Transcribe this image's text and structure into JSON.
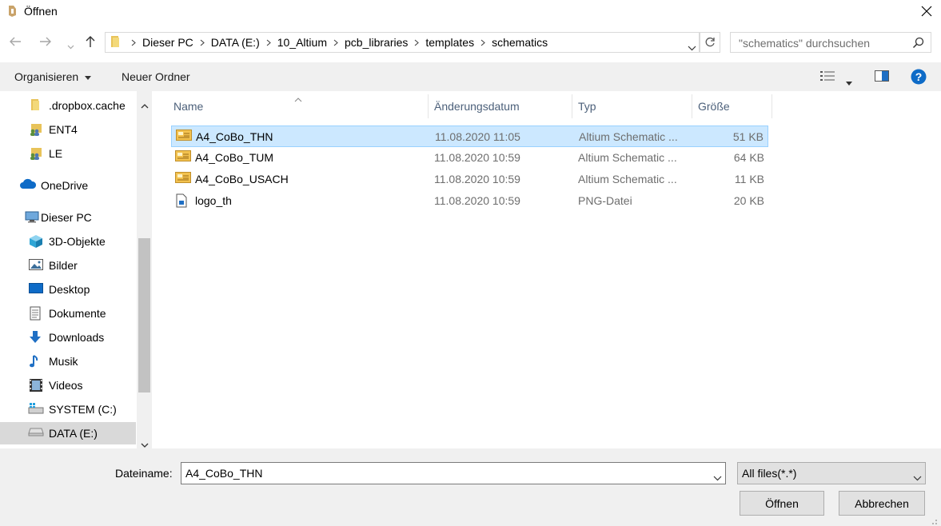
{
  "window": {
    "title": "Öffnen"
  },
  "address": {
    "crumbs": [
      "Dieser PC",
      "DATA (E:)",
      "10_Altium",
      "pcb_libraries",
      "templates",
      "schematics"
    ]
  },
  "search": {
    "placeholder": "\"schematics\" durchsuchen"
  },
  "toolbar": {
    "organize": "Organisieren",
    "new_folder": "Neuer Ordner"
  },
  "nav_pane": {
    "items": [
      {
        "label": ".dropbox.cache",
        "icon": "folder-icon"
      },
      {
        "label": "ENT4",
        "icon": "shared-folder-icon"
      },
      {
        "label": "LE",
        "icon": "shared-folder-icon"
      },
      {
        "label": "OneDrive",
        "icon": "cloud-icon"
      },
      {
        "label": "Dieser PC",
        "icon": "computer-icon"
      },
      {
        "label": "3D-Objekte",
        "icon": "cube-icon"
      },
      {
        "label": "Bilder",
        "icon": "pictures-icon"
      },
      {
        "label": "Desktop",
        "icon": "desktop-icon"
      },
      {
        "label": "Dokumente",
        "icon": "documents-icon"
      },
      {
        "label": "Downloads",
        "icon": "download-icon"
      },
      {
        "label": "Musik",
        "icon": "music-icon"
      },
      {
        "label": "Videos",
        "icon": "videos-icon"
      },
      {
        "label": "SYSTEM (C:)",
        "icon": "windows-drive-icon"
      },
      {
        "label": "DATA (E:)",
        "icon": "drive-icon",
        "selected": true
      }
    ]
  },
  "columns": {
    "name": "Name",
    "date": "Änderungsdatum",
    "type": "Typ",
    "size": "Größe"
  },
  "files": [
    {
      "name": "A4_CoBo_THN",
      "date": "11.08.2020 11:05",
      "type": "Altium Schematic ...",
      "size": "51 KB",
      "icon": "schematic-file-icon",
      "selected": true
    },
    {
      "name": "A4_CoBo_TUM",
      "date": "11.08.2020 10:59",
      "type": "Altium Schematic ...",
      "size": "64 KB",
      "icon": "schematic-file-icon"
    },
    {
      "name": "A4_CoBo_USACH",
      "date": "11.08.2020 10:59",
      "type": "Altium Schematic ...",
      "size": "11 KB",
      "icon": "schematic-file-icon"
    },
    {
      "name": "logo_th",
      "date": "11.08.2020 10:59",
      "type": "PNG-Datei",
      "size": "20 KB",
      "icon": "image-file-icon"
    }
  ],
  "footer": {
    "filename_label": "Dateiname:",
    "filename_value": "A4_CoBo_THN",
    "filetype_value": "All files(*.*)",
    "open_label": "Öffnen",
    "cancel_label": "Abbrechen"
  },
  "colors": {
    "selection_bg": "#cce8ff",
    "selection_border": "#99d1ff",
    "help_blue": "#0e6bc7",
    "header_text": "#4c607a"
  }
}
